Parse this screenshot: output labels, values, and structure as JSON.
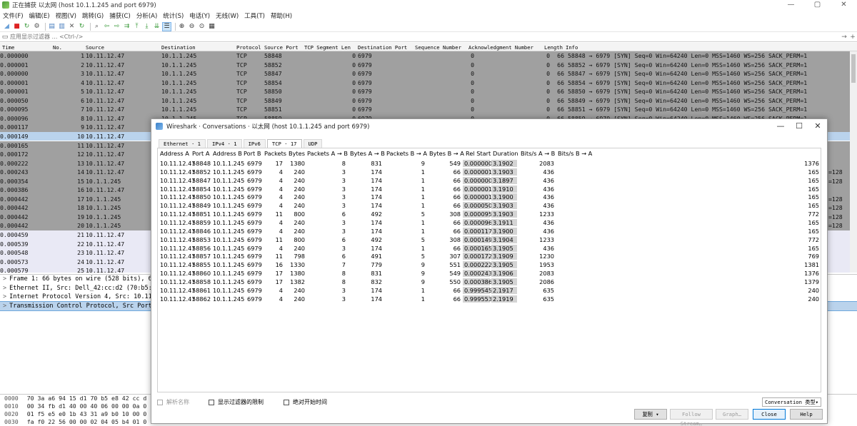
{
  "window": {
    "title": "正在捕获 以太网 (host  10.1.1.245  and port 6979)",
    "controls": [
      "—",
      "▢",
      "✕"
    ]
  },
  "menu": [
    "文件(F)",
    "编辑(E)",
    "视图(V)",
    "跳转(G)",
    "捕获(C)",
    "分析(A)",
    "统计(S)",
    "电话(Y)",
    "无线(W)",
    "工具(T)",
    "帮助(H)"
  ],
  "filter": {
    "placeholder": "应用显示过滤器 … <Ctrl-/>"
  },
  "packet_list": {
    "columns": [
      "Time",
      "No.",
      "Source",
      "Destination",
      "Protocol",
      "Source Port",
      "TCP Segment Len",
      "Destination Port",
      "Sequence Number",
      "Acknowledgment Number",
      "Length",
      "Info"
    ],
    "rows": [
      [
        "0.000000",
        "1",
        "10.11.12.47",
        "10.1.1.245",
        "TCP",
        "58848",
        "0",
        "6979",
        "0",
        "0",
        "66",
        "58848 → 6979 [SYN] Seq=0 Win=64240 Len=0 MSS=1460 WS=256 SACK_PERM=1"
      ],
      [
        "0.000001",
        "2",
        "10.11.12.47",
        "10.1.1.245",
        "TCP",
        "58852",
        "0",
        "6979",
        "0",
        "0",
        "66",
        "58852 → 6979 [SYN] Seq=0 Win=64240 Len=0 MSS=1460 WS=256 SACK_PERM=1"
      ],
      [
        "0.000000",
        "3",
        "10.11.12.47",
        "10.1.1.245",
        "TCP",
        "58847",
        "0",
        "6979",
        "0",
        "0",
        "66",
        "58847 → 6979 [SYN] Seq=0 Win=64240 Len=0 MSS=1460 WS=256 SACK_PERM=1"
      ],
      [
        "0.000001",
        "4",
        "10.11.12.47",
        "10.1.1.245",
        "TCP",
        "58854",
        "0",
        "6979",
        "0",
        "0",
        "66",
        "58854 → 6979 [SYN] Seq=0 Win=64240 Len=0 MSS=1460 WS=256 SACK_PERM=1"
      ],
      [
        "0.000001",
        "5",
        "10.11.12.47",
        "10.1.1.245",
        "TCP",
        "58850",
        "0",
        "6979",
        "0",
        "0",
        "66",
        "58850 → 6979 [SYN] Seq=0 Win=64240 Len=0 MSS=1460 WS=256 SACK_PERM=1"
      ],
      [
        "0.000050",
        "6",
        "10.11.12.47",
        "10.1.1.245",
        "TCP",
        "58849",
        "0",
        "6979",
        "0",
        "0",
        "66",
        "58849 → 6979 [SYN] Seq=0 Win=64240 Len=0 MSS=1460 WS=256 SACK_PERM=1"
      ],
      [
        "0.000095",
        "7",
        "10.11.12.47",
        "10.1.1.245",
        "TCP",
        "58851",
        "0",
        "6979",
        "0",
        "0",
        "66",
        "58851 → 6979 [SYN] Seq=0 Win=64240 Len=0 MSS=1460 WS=256 SACK_PERM=1"
      ],
      [
        "0.000096",
        "8",
        "10.11.12.47",
        "10.1.1.245",
        "TCP",
        "58859",
        "0",
        "6979",
        "0",
        "0",
        "66",
        "58859 → 6979 [SYN] Seq=0 Win=64240 Len=0 MSS=1460 WS=256 SACK_PERM=1"
      ],
      [
        "0.000117",
        "9",
        "10.11.12.47",
        "",
        "",
        "",
        "",
        "",
        "",
        "",
        "",
        ""
      ],
      [
        "0.000149",
        "10",
        "10.11.12.47",
        "",
        "",
        "",
        "",
        "",
        "",
        "",
        "",
        ""
      ],
      [
        "0.000165",
        "11",
        "10.11.12.47",
        "",
        "",
        "",
        "",
        "",
        "",
        "",
        "",
        ""
      ],
      [
        "0.000172",
        "12",
        "10.11.12.47",
        "",
        "",
        "",
        "",
        "",
        "",
        "",
        "",
        ""
      ],
      [
        "0.000222",
        "13",
        "10.11.12.47",
        "",
        "",
        "",
        "",
        "",
        "",
        "",
        "",
        ""
      ],
      [
        "0.000243",
        "14",
        "10.11.12.47",
        "",
        "",
        "",
        "",
        "",
        "",
        "",
        "",
        "=128"
      ],
      [
        "0.000354",
        "15",
        "10.1.1.245",
        "",
        "",
        "",
        "",
        "",
        "",
        "",
        "",
        "=128"
      ],
      [
        "0.000386",
        "16",
        "10.11.12.47",
        "",
        "",
        "",
        "",
        "",
        "",
        "",
        "",
        ""
      ],
      [
        "0.000442",
        "17",
        "10.1.1.245",
        "",
        "",
        "",
        "",
        "",
        "",
        "",
        "",
        "=128"
      ],
      [
        "0.000442",
        "18",
        "10.1.1.245",
        "",
        "",
        "",
        "",
        "",
        "",
        "",
        "",
        "=128"
      ],
      [
        "0.000442",
        "19",
        "10.1.1.245",
        "",
        "",
        "",
        "",
        "",
        "",
        "",
        "",
        "=128"
      ],
      [
        "0.000442",
        "20",
        "10.1.1.245",
        "",
        "",
        "",
        "",
        "",
        "",
        "",
        "",
        "=128"
      ],
      [
        "0.000459",
        "21",
        "10.11.12.47",
        "",
        "",
        "",
        "",
        "",
        "",
        "",
        "",
        ""
      ],
      [
        "0.000539",
        "22",
        "10.11.12.47",
        "",
        "",
        "",
        "",
        "",
        "",
        "",
        "",
        ""
      ],
      [
        "0.000548",
        "23",
        "10.11.12.47",
        "",
        "",
        "",
        "",
        "",
        "",
        "",
        "",
        ""
      ],
      [
        "0.000573",
        "24",
        "10.11.12.47",
        "",
        "",
        "",
        "",
        "",
        "",
        "",
        "",
        ""
      ],
      [
        "0.000579",
        "25",
        "10.11.12.47",
        "",
        "",
        "",
        "",
        "",
        "",
        "",
        "",
        ""
      ]
    ]
  },
  "details": [
    "Frame 1: 66 bytes on wire (528 bits), 66",
    "Ethernet II, Src: Dell_42:cc:d2 (70:b5:e",
    "Internet Protocol Version 4, Src: 10.11",
    "Transmission Control Protocol, Src Port"
  ],
  "bytes": [
    [
      "0000",
      "70 3a a6 94 15 d1 70 b5  e8 42 cc d"
    ],
    [
      "0010",
      "00 34 fb d1 40 00 40 06  00 00 0a 0"
    ],
    [
      "0020",
      "01 f5 e5 e0 1b 43 31 a9  b0 10 00 0"
    ],
    [
      "0030",
      "fa f0 22 56 00 00 02 04  05 b4 01 0"
    ]
  ],
  "dialog": {
    "title": "Wireshark · Conversations · 以太网 (host  10.1.1.245  and port 6979)",
    "controls": [
      "—",
      "☐",
      "✕"
    ],
    "tabs": [
      "Ethernet · 1",
      "IPv4 · 1",
      "IPv6",
      "TCP · 17",
      "UDP"
    ],
    "active_tab": "TCP · 17",
    "columns": [
      "Address A",
      "Port A",
      "Address B",
      "Port B",
      "Packets",
      "Bytes",
      "Packets A → B",
      "Bytes A → B",
      "Packets B → A",
      "Bytes B → A",
      "Rel Start",
      "Duration",
      "Bits/s A → B",
      "Bits/s B → A"
    ],
    "rows": [
      [
        "10.11.12.47",
        "58848",
        "10.1.1.245",
        "6979",
        "17",
        "1380",
        "8",
        "831",
        "9",
        "549",
        "0.000000",
        "3.1902",
        "2083",
        "1376"
      ],
      [
        "10.11.12.47",
        "58852",
        "10.1.1.245",
        "6979",
        "4",
        "240",
        "3",
        "174",
        "1",
        "66",
        "0.000001",
        "3.1903",
        "436",
        "165"
      ],
      [
        "10.11.12.47",
        "58847",
        "10.1.1.245",
        "6979",
        "4",
        "240",
        "3",
        "174",
        "1",
        "66",
        "0.000000",
        "3.1897",
        "436",
        "165"
      ],
      [
        "10.11.12.47",
        "58854",
        "10.1.1.245",
        "6979",
        "4",
        "240",
        "3",
        "174",
        "1",
        "66",
        "0.000001",
        "3.1910",
        "436",
        "165"
      ],
      [
        "10.11.12.47",
        "58850",
        "10.1.1.245",
        "6979",
        "4",
        "240",
        "3",
        "174",
        "1",
        "66",
        "0.000001",
        "3.1900",
        "436",
        "165"
      ],
      [
        "10.11.12.47",
        "58849",
        "10.1.1.245",
        "6979",
        "4",
        "240",
        "3",
        "174",
        "1",
        "66",
        "0.000050",
        "3.1903",
        "436",
        "165"
      ],
      [
        "10.11.12.47",
        "58851",
        "10.1.1.245",
        "6979",
        "11",
        "800",
        "6",
        "492",
        "5",
        "308",
        "0.000095",
        "3.1903",
        "1233",
        "772"
      ],
      [
        "10.11.12.47",
        "58859",
        "10.1.1.245",
        "6979",
        "4",
        "240",
        "3",
        "174",
        "1",
        "66",
        "0.000096",
        "3.1911",
        "436",
        "165"
      ],
      [
        "10.11.12.47",
        "58846",
        "10.1.1.245",
        "6979",
        "4",
        "240",
        "3",
        "174",
        "1",
        "66",
        "0.000117",
        "3.1900",
        "436",
        "165"
      ],
      [
        "10.11.12.47",
        "58853",
        "10.1.1.245",
        "6979",
        "11",
        "800",
        "6",
        "492",
        "5",
        "308",
        "0.000149",
        "3.1904",
        "1233",
        "772"
      ],
      [
        "10.11.12.47",
        "58856",
        "10.1.1.245",
        "6979",
        "4",
        "240",
        "3",
        "174",
        "1",
        "66",
        "0.000165",
        "3.1905",
        "436",
        "165"
      ],
      [
        "10.11.12.47",
        "58857",
        "10.1.1.245",
        "6979",
        "11",
        "798",
        "6",
        "491",
        "5",
        "307",
        "0.000172",
        "3.1909",
        "1230",
        "769"
      ],
      [
        "10.11.12.47",
        "58855",
        "10.1.1.245",
        "6979",
        "16",
        "1330",
        "7",
        "779",
        "9",
        "551",
        "0.000222",
        "3.1905",
        "1953",
        "1381"
      ],
      [
        "10.11.12.47",
        "58860",
        "10.1.1.245",
        "6979",
        "17",
        "1380",
        "8",
        "831",
        "9",
        "549",
        "0.000243",
        "3.1906",
        "2083",
        "1376"
      ],
      [
        "10.11.12.47",
        "58858",
        "10.1.1.245",
        "6979",
        "17",
        "1382",
        "8",
        "832",
        "9",
        "550",
        "0.000386",
        "3.1905",
        "2086",
        "1379"
      ],
      [
        "10.11.12.47",
        "58861",
        "10.1.1.245",
        "6979",
        "4",
        "240",
        "3",
        "174",
        "1",
        "66",
        "0.999545",
        "2.1917",
        "635",
        "240"
      ],
      [
        "10.11.12.47",
        "58862",
        "10.1.1.245",
        "6979",
        "4",
        "240",
        "3",
        "174",
        "1",
        "66",
        "0.999553",
        "2.1919",
        "635",
        "240"
      ]
    ],
    "checkboxes": [
      {
        "label": "解析名称",
        "enabled": false
      },
      {
        "label": "显示过滤器的限制",
        "enabled": true
      },
      {
        "label": "绝对开始时间",
        "enabled": true
      }
    ],
    "conversation_type": "Conversation 类型▾",
    "buttons": {
      "copy": "复制",
      "follow": "Follow Stream…",
      "graph": "Graph…",
      "close": "Close",
      "help": "Help"
    }
  }
}
